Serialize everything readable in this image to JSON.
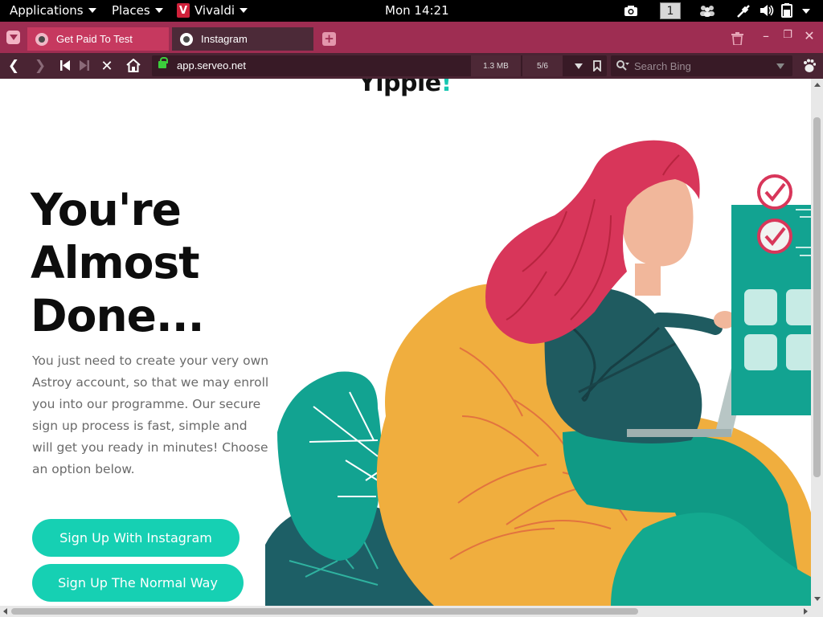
{
  "topbar": {
    "applications": "Applications",
    "places": "Places",
    "app_name": "Vivaldi",
    "app_logo_letter": "V",
    "clock": "Mon 14:21",
    "workspace": "1"
  },
  "browser": {
    "tabs": [
      {
        "title": "Get Paid To Test",
        "active": false
      },
      {
        "title": "Instagram",
        "active": true
      }
    ],
    "url": "app.serveo.net",
    "page_size": "1.3 MB",
    "page_counter": "5/6",
    "search_placeholder": "Search Bing"
  },
  "page": {
    "brand_main": "Yipple",
    "brand_accent": "!",
    "headline_line1": "You're",
    "headline_line2": "Almost",
    "headline_line3": "Done...",
    "body": "You just need to create your very own Astroy account, so that we may enroll you into our programme. Our secure sign up process is fast, simple and will get you ready in minutes! Choose an option below.",
    "cta_instagram": "Sign Up With Instagram",
    "cta_normal": "Sign Up The Normal Way"
  },
  "colors": {
    "accent_teal": "#16d0b3",
    "tab_bar": "#9e2d52",
    "hair_pink": "#d8365a",
    "chair_yellow": "#f0ae3e"
  }
}
